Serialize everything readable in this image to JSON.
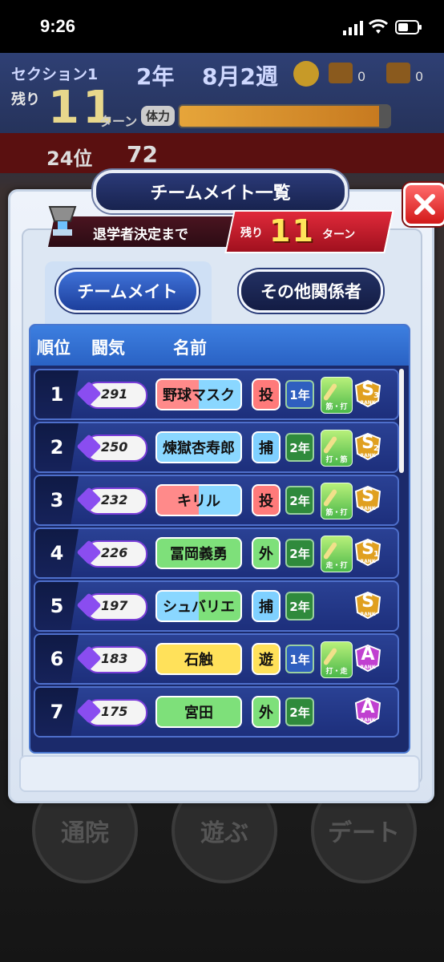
{
  "status_bar": {
    "time": "9:26"
  },
  "hud": {
    "section": "セクション1",
    "year": "2年",
    "week": "8月2週",
    "chest1": "0",
    "chest2": "0",
    "remain": "残り",
    "turns": "11",
    "turn_label": "ターン",
    "stamina_label": "体力",
    "stamina_level": 0.95,
    "rank": "24位",
    "spirit": "72"
  },
  "modal": {
    "title": "チームメイト一覧",
    "graduation_label": "退学者決定まで",
    "graduation_remain": "残り",
    "graduation_turns": "11",
    "graduation_turn_label": "ターン",
    "tabs": {
      "teammates": "チームメイト",
      "others": "その他関係者"
    },
    "headers": {
      "rank": "順位",
      "spirit": "闘気",
      "name": "名前"
    }
  },
  "bottom_buttons": {
    "hospital": "通院",
    "play": "遊ぶ",
    "date": "デート"
  },
  "rows": [
    {
      "rank": "1",
      "spirit": "291",
      "name": "野球マスク",
      "name_colors": [
        "#ff8a8a",
        "#8ad7ff"
      ],
      "position": "投",
      "position_color": "#ff7a7a",
      "grade": "1年",
      "grade_color": "#2f5fbf",
      "training": "筋・打",
      "rank_letter": "S",
      "rank_sub": "3",
      "rank_color": "#e0a020"
    },
    {
      "rank": "2",
      "spirit": "250",
      "name": "煉獄杏寿郎",
      "name_colors": [
        "#8ad7ff",
        "#8ad7ff"
      ],
      "position": "捕",
      "position_color": "#7fd0ff",
      "grade": "2年",
      "grade_color": "#2f8a3c",
      "training": "打・筋",
      "rank_letter": "S",
      "rank_sub": "2",
      "rank_color": "#e0a020"
    },
    {
      "rank": "3",
      "spirit": "232",
      "name": "キリル",
      "name_colors": [
        "#ff8a8a",
        "#8ad7ff"
      ],
      "position": "投",
      "position_color": "#ff7a7a",
      "grade": "2年",
      "grade_color": "#2f8a3c",
      "training": "筋・打",
      "rank_letter": "S",
      "rank_sub": "",
      "rank_color": "#e0a020"
    },
    {
      "rank": "4",
      "spirit": "226",
      "name": "冨岡義勇",
      "name_colors": [
        "#7ee07a",
        "#7ee07a"
      ],
      "position": "外",
      "position_color": "#7ee07a",
      "grade": "2年",
      "grade_color": "#2f8a3c",
      "training": "走・打",
      "rank_letter": "S",
      "rank_sub": "1",
      "rank_color": "#e0a020"
    },
    {
      "rank": "5",
      "spirit": "197",
      "name": "シュバリエ",
      "name_colors": [
        "#8ad7ff",
        "#7ee07a"
      ],
      "position": "捕",
      "position_color": "#7fd0ff",
      "grade": "2年",
      "grade_color": "#2f8a3c",
      "training": "",
      "rank_letter": "S",
      "rank_sub": "",
      "rank_color": "#e0a020"
    },
    {
      "rank": "6",
      "spirit": "183",
      "name": "石触",
      "name_colors": [
        "#ffe15a",
        "#ffe15a"
      ],
      "position": "遊",
      "position_color": "#ffe15a",
      "grade": "1年",
      "grade_color": "#2f5fbf",
      "training": "打・走",
      "rank_letter": "A",
      "rank_sub": "",
      "rank_color": "#c040d0"
    },
    {
      "rank": "7",
      "spirit": "175",
      "name": "宮田",
      "name_colors": [
        "#7ee07a",
        "#7ee07a"
      ],
      "position": "外",
      "position_color": "#7ee07a",
      "grade": "2年",
      "grade_color": "#2f8a3c",
      "training": "",
      "rank_letter": "A",
      "rank_sub": "",
      "rank_color": "#c040d0"
    }
  ]
}
